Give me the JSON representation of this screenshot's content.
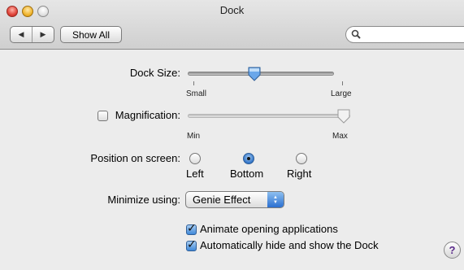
{
  "window": {
    "title": "Dock"
  },
  "toolbar": {
    "back_glyph": "◀",
    "forward_glyph": "▶",
    "show_all_label": "Show All",
    "search_placeholder": ""
  },
  "dock_size": {
    "label": "Dock Size:",
    "min_label": "Small",
    "max_label": "Large",
    "value_fraction": 0.45
  },
  "magnification": {
    "label": "Magnification:",
    "checked": false,
    "min_label": "Min",
    "max_label": "Max",
    "value_fraction": 1.0
  },
  "position": {
    "label": "Position on screen:",
    "options": [
      "Left",
      "Bottom",
      "Right"
    ],
    "selected": "Bottom"
  },
  "minimize": {
    "label": "Minimize using:",
    "selected": "Genie Effect"
  },
  "options": {
    "animate_label": "Animate opening applications",
    "animate_checked": true,
    "autohide_label": "Automatically hide and show the Dock",
    "autohide_checked": true
  },
  "help": {
    "glyph": "?"
  },
  "colors": {
    "accent": "#3f88d8",
    "help_glyph": "#5a2a8a"
  }
}
